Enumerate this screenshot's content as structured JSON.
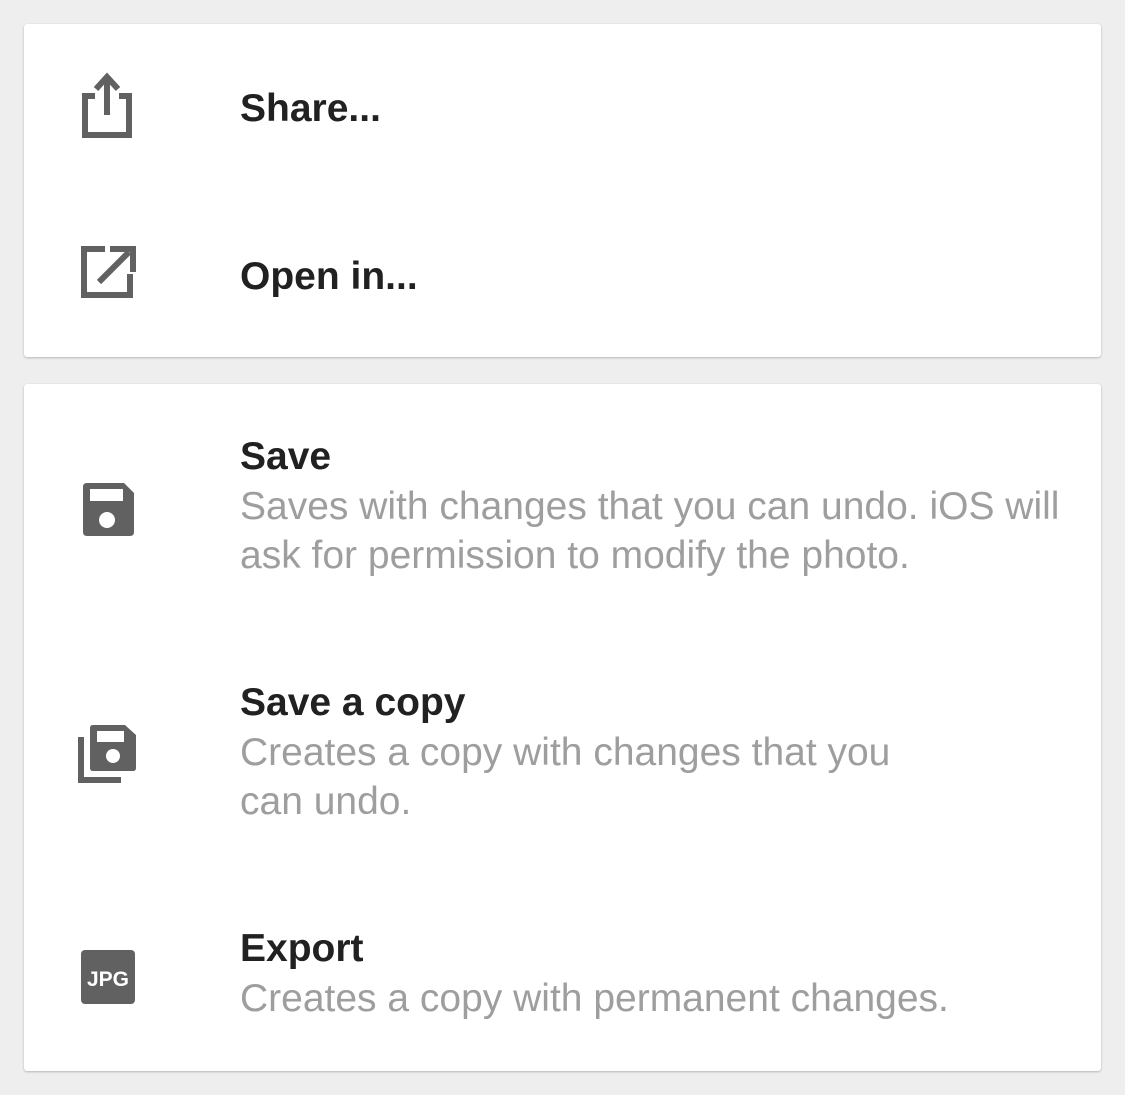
{
  "colors": {
    "background": "#eeeeee",
    "card": "#ffffff",
    "icon": "#616161",
    "label": "#212121",
    "description": "#9e9e9e"
  },
  "share_menu": {
    "items": [
      {
        "label": "Share...",
        "icon": "share-icon"
      },
      {
        "label": "Open in...",
        "icon": "open-in-new-icon"
      }
    ]
  },
  "save_menu": {
    "items": [
      {
        "label": "Save",
        "description": "Saves with changes that you can undo. iOS will ask for permission to modify the photo.",
        "icon": "save-icon"
      },
      {
        "label": "Save a copy",
        "description": "Creates a copy with changes that you can undo.",
        "icon": "save-copy-icon"
      },
      {
        "label": "Export",
        "description": "Creates a copy with permanent changes.",
        "icon": "jpg-icon",
        "icon_text": "JPG"
      }
    ]
  }
}
